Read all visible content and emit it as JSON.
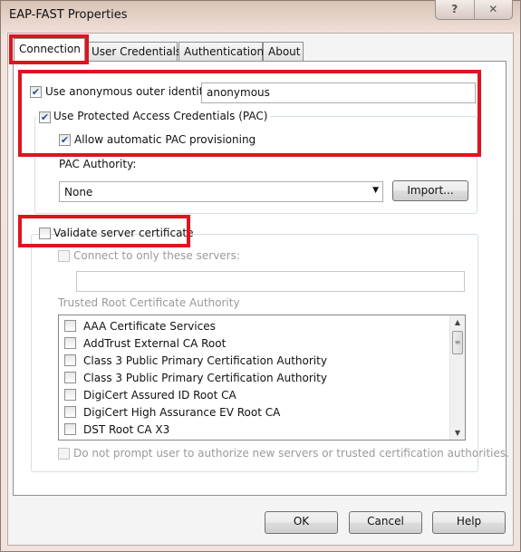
{
  "window": {
    "title": "EAP-FAST Properties",
    "help_button": "?",
    "close_button": "✕"
  },
  "tabs": [
    {
      "label": "Connection",
      "active": true
    },
    {
      "label": "User Credentials"
    },
    {
      "label": "Authentication"
    },
    {
      "label": "About"
    }
  ],
  "connection": {
    "anon_identity": {
      "label": "Use anonymous outer identity",
      "checked": true,
      "value": "anonymous"
    },
    "pac": {
      "label": "Use Protected Access Credentials (PAC)",
      "checked": true
    },
    "auto_pac": {
      "label": "Allow automatic PAC provisioning",
      "checked": true
    },
    "pac_authority_label": "PAC Authority:",
    "pac_authority_value": "None",
    "import_button": "Import...",
    "validate": {
      "label": "Validate server certificate",
      "checked": false
    },
    "connect_servers": {
      "label": "Connect to only these servers:",
      "checked": false,
      "value": ""
    },
    "trusted_root_label": "Trusted Root Certificate Authority",
    "ca_list": [
      "AAA Certificate Services",
      "AddTrust External CA Root",
      "Class 3 Public Primary Certification Authority",
      "Class 3 Public Primary Certification Authority",
      "DigiCert Assured ID Root CA",
      "DigiCert High Assurance EV Root CA",
      "DST Root CA X3"
    ],
    "no_prompt": {
      "label": "Do not prompt user to authorize new servers or trusted certification authorities.",
      "checked": false
    }
  },
  "buttons": {
    "ok": "OK",
    "cancel": "Cancel",
    "help": "Help"
  },
  "colors": {
    "highlight": "#e0141e",
    "check": "#2a4d9c"
  }
}
